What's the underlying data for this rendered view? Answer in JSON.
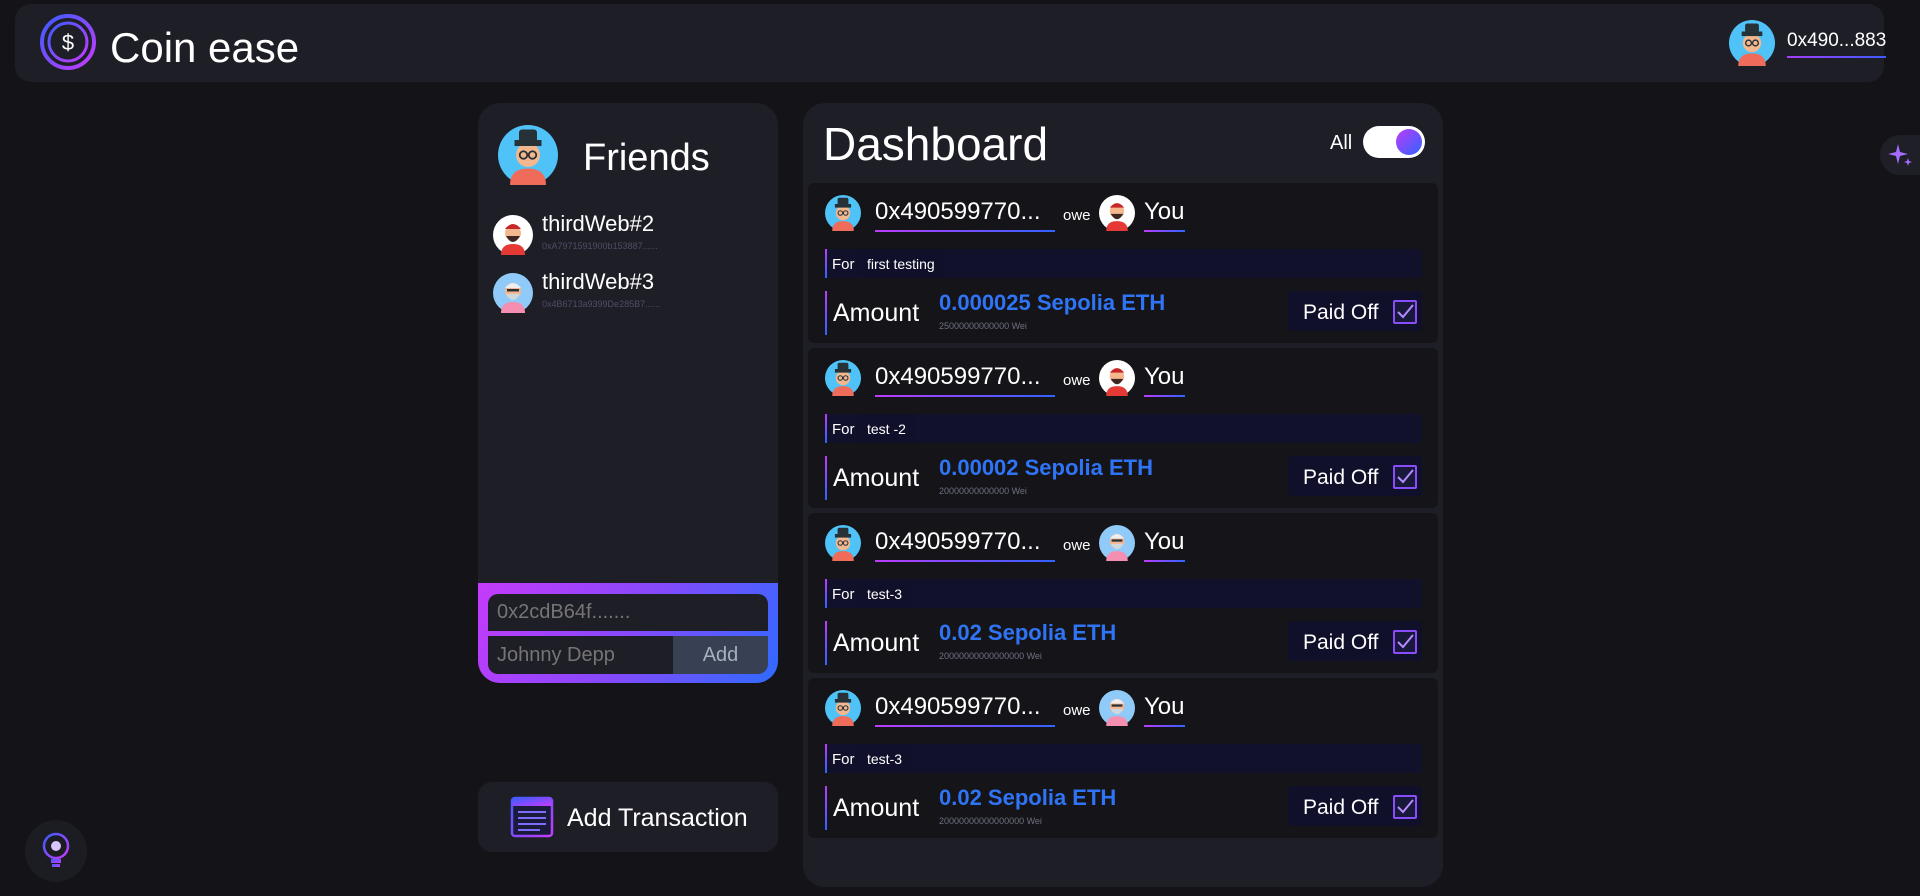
{
  "header": {
    "app_title": "Coin ease",
    "logo_icon": "dollar-coin-icon",
    "user_address": "0x490...883"
  },
  "friends": {
    "title": "Friends",
    "items": [
      {
        "name": "thirdWeb#2",
        "address": "0xA7971591900b153887......"
      },
      {
        "name": "thirdWeb#3",
        "address": "0x4B6713a9399De285B7......"
      }
    ],
    "add_form": {
      "address_placeholder": "0x2cdB64f.......",
      "name_placeholder": "Johnny Depp",
      "add_label": "Add"
    }
  },
  "add_transaction": {
    "label": "Add Transaction",
    "icon": "spreadsheet-icon"
  },
  "dashboard": {
    "title": "Dashboard",
    "toggle_label": "All",
    "toggle_on": true,
    "transactions": [
      {
        "from": "0x490599770...",
        "relation": "owe",
        "to": "You",
        "for_label": "For",
        "for": "first testing",
        "amount_label": "Amount",
        "amount_eth": "0.000025 Sepolia ETH",
        "amount_wei": "25000000000000 Wei",
        "status": "Paid Off",
        "to_avatar": "red"
      },
      {
        "from": "0x490599770...",
        "relation": "owe",
        "to": "You",
        "for_label": "For",
        "for": "test -2",
        "amount_label": "Amount",
        "amount_eth": "0.00002 Sepolia ETH",
        "amount_wei": "20000000000000 Wei",
        "status": "Paid Off",
        "to_avatar": "red"
      },
      {
        "from": "0x490599770...",
        "relation": "owe",
        "to": "You",
        "for_label": "For",
        "for": "test-3",
        "amount_label": "Amount",
        "amount_eth": "0.02 Sepolia ETH",
        "amount_wei": "20000000000000000 Wei",
        "status": "Paid Off",
        "to_avatar": "pink"
      },
      {
        "from": "0x490599770...",
        "relation": "owe",
        "to": "You",
        "for_label": "For",
        "for": "test-3",
        "amount_label": "Amount",
        "amount_eth": "0.02 Sepolia ETH",
        "amount_wei": "20000000000000000 Wei",
        "status": "Paid Off",
        "to_avatar": "pink"
      }
    ]
  },
  "widgets": {
    "sparkle": "sparkle-icon",
    "bulb": "lightbulb-icon"
  },
  "colors": {
    "background": "#131318",
    "panel": "#1e1e27",
    "accent_purple": "#bd3cfb",
    "accent_blue": "#2f63ff",
    "amount_blue": "#2f74f5"
  }
}
